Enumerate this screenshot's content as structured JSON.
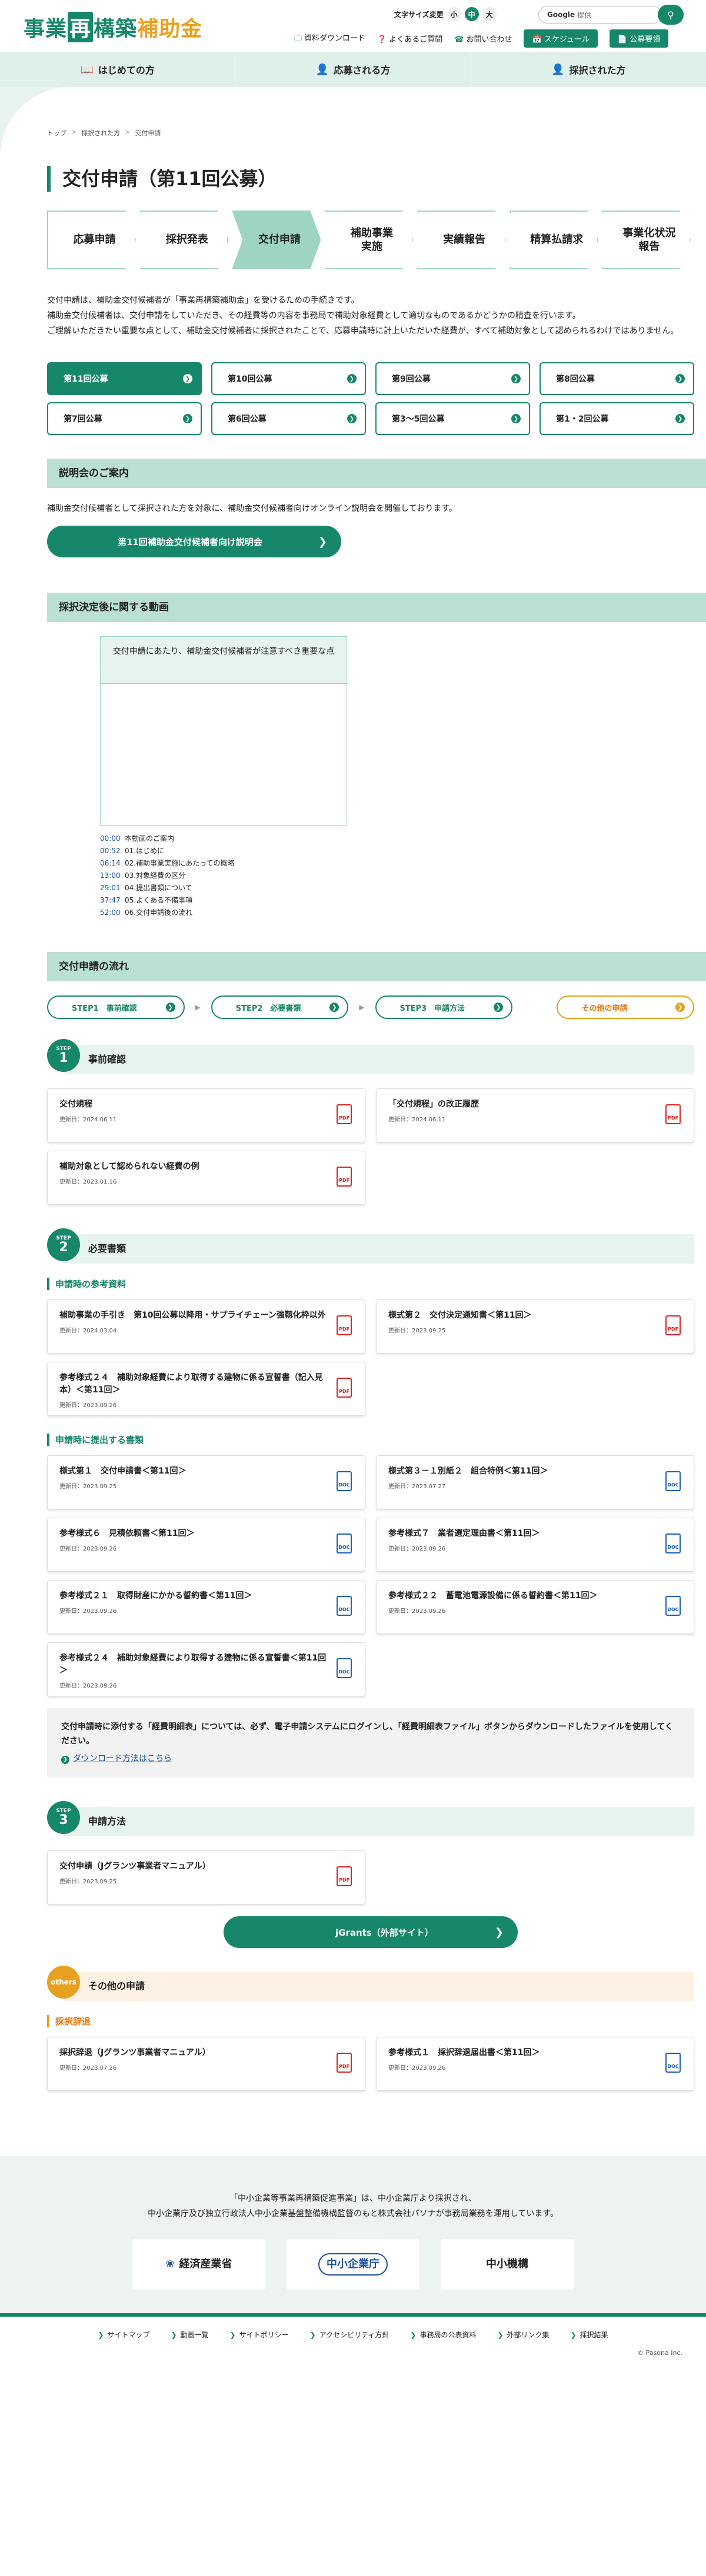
{
  "header": {
    "logo": {
      "part1": "事業",
      "boxed": "再",
      "part2": "構築",
      "part3": "補助金"
    },
    "font_size_label": "文字サイズ変更",
    "font_sizes": [
      "小",
      "中",
      "大"
    ],
    "search_brand": "Google",
    "search_placeholder": "提供",
    "links": [
      "資料ダウンロード",
      "よくあるご質問",
      "お問い合わせ"
    ],
    "btn_schedule": "スケジュール",
    "btn_koubo": "公募要領"
  },
  "gnav": [
    "はじめての方",
    "応募される方",
    "採択された方"
  ],
  "breadcrumb": [
    "トップ",
    "採択された方",
    "交付申請"
  ],
  "page_title": "交付申請（第11回公募）",
  "steps": [
    "応募申請",
    "採択発表",
    "交付申請",
    "補助事業\n実施",
    "実績報告",
    "精算払請求",
    "事業化状況\n報告"
  ],
  "intro": [
    "交付申請は、補助金交付候補者が「事業再構築補助金」を受けるための手続きです。",
    "補助金交付候補者は、交付申請をしていただき、その経費等の内容を事務局で補助対象経費として適切なものであるかどうかの精査を行います。",
    "ご理解いただきたい重要な点として、補助金交付候補者に採択されたことで、応募申請時に計上いただいた経費が、すべて補助対象として認められるわけではありません。"
  ],
  "rounds": [
    "第11回公募",
    "第10回公募",
    "第9回公募",
    "第8回公募",
    "第7回公募",
    "第6回公募",
    "第3〜5回公募",
    "第1・2回公募"
  ],
  "briefing": {
    "heading": "説明会のご案内",
    "text": "補助金交付候補者として採択された方を対象に、補助金交付候補者向けオンライン説明会を開催しております。",
    "button": "第11回補助金交付候補者向け説明会"
  },
  "video": {
    "heading": "採択決定後に関する動画",
    "title": "交付申請にあたり、補助金交付候補者が注意すべき重要な点",
    "chapters": [
      {
        "t": "00:00",
        "label": "本動画のご案内"
      },
      {
        "t": "00:52",
        "label": "01.はじめに"
      },
      {
        "t": "06:14",
        "label": "02.補助事業実施にあたっての概略"
      },
      {
        "t": "13:00",
        "label": "03.対象経費の区分"
      },
      {
        "t": "29:01",
        "label": "04.提出書類について"
      },
      {
        "t": "37:47",
        "label": "05.よくある不備事項"
      },
      {
        "t": "52:00",
        "label": "06.交付申請後の流れ"
      }
    ]
  },
  "flow": {
    "heading": "交付申請の流れ",
    "nav": [
      "STEP1　事前確認",
      "STEP2　必要書類",
      "STEP3　申請方法",
      "その他の申請"
    ]
  },
  "step1": {
    "badge_label": "STEP",
    "badge_num": "1",
    "title": "事前確認",
    "docs": [
      {
        "title": "交付規程",
        "date": "更新日：2024.06.11",
        "type": "PDF"
      },
      {
        "title": "「交付規程」の改正履歴",
        "date": "更新日：2024.06.11",
        "type": "PDF"
      },
      {
        "title": "補助対象として認められない経費の例",
        "date": "更新日：2023.01.16",
        "type": "PDF"
      }
    ]
  },
  "step2": {
    "badge_label": "STEP",
    "badge_num": "2",
    "title": "必要書類",
    "sub1": "申請時の参考資料",
    "docs1": [
      {
        "title": "補助事業の手引き　第10回公募以降用・サプライチェーン強靱化枠以外",
        "date": "更新日：2024.03.04",
        "type": "PDF"
      },
      {
        "title": "様式第２　交付決定通知書＜第11回＞",
        "date": "更新日：2023.09.25",
        "type": "PDF"
      },
      {
        "title": "参考様式２４　補助対象経費により取得する建物に係る宣誓書（記入見本）＜第11回＞",
        "date": "更新日：2023.09.26",
        "type": "PDF"
      }
    ],
    "sub2": "申請時に提出する書類",
    "docs2": [
      {
        "title": "様式第１　交付申請書＜第11回＞",
        "date": "更新日：2023.09.25",
        "type": "DOC"
      },
      {
        "title": "様式第３－１別紙２　組合特例＜第11回＞",
        "date": "更新日：2023.07.27",
        "type": "DOC"
      },
      {
        "title": "参考様式６　見積依頼書＜第11回＞",
        "date": "更新日：2023.09.26",
        "type": "DOC"
      },
      {
        "title": "参考様式７　業者選定理由書＜第11回＞",
        "date": "更新日：2023.09.26",
        "type": "DOC"
      },
      {
        "title": "参考様式２１　取得財産にかかる誓約書＜第11回＞",
        "date": "更新日：2023.09.26",
        "type": "DOC"
      },
      {
        "title": "参考様式２２　蓄電池電源設備に係る誓約書＜第11回＞",
        "date": "更新日：2023.09.26",
        "type": "DOC"
      },
      {
        "title": "参考様式２４　補助対象経費により取得する建物に係る宣誓書＜第11回＞",
        "date": "更新日：2023.09.26",
        "type": "DOC"
      }
    ],
    "note": "交付申請時に添付する「経費明細表」については、必ず、電子申請システムにログインし、「経費明細表ファイル」ボタンからダウンロードしたファイルを使用してください。",
    "note_link": "ダウンロード方法はこちら"
  },
  "step3": {
    "badge_label": "STEP",
    "badge_num": "3",
    "title": "申請方法",
    "docs": [
      {
        "title": "交付申請（Jグランツ事業者マニュアル）",
        "date": "更新日：2023.09.25",
        "type": "PDF"
      }
    ],
    "button": "jGrants（外部サイト）"
  },
  "others": {
    "badge": "others",
    "title": "その他の申請",
    "sub": "採択辞退",
    "docs": [
      {
        "title": "採択辞退（Jグランツ事業者マニュアル）",
        "date": "更新日：2023.07.26",
        "type": "PDF"
      },
      {
        "title": "参考様式１　採択辞退届出書＜第11回＞",
        "date": "更新日：2023.09.26",
        "type": "DOC"
      }
    ]
  },
  "footer": {
    "line1": "「中小企業等事業再構築促進事業」は、中小企業庁より採択され、",
    "line2": "中小企業庁及び独立行政法人中小企業基盤整備機構監督のもと株式会社パソナが事務局業務を運用しています。",
    "logos": [
      "経済産業省",
      "中小企業庁",
      "中小機構"
    ],
    "links": [
      "サイトマップ",
      "動画一覧",
      "サイトポリシー",
      "アクセシビリティ方針",
      "事務局の公表資料",
      "外部リンク集",
      "採択結果"
    ],
    "copyright": "© Pasona Inc."
  },
  "colors": {
    "primary": "#16876a",
    "light": "#e7f3ef",
    "accent": "#e8a020"
  }
}
